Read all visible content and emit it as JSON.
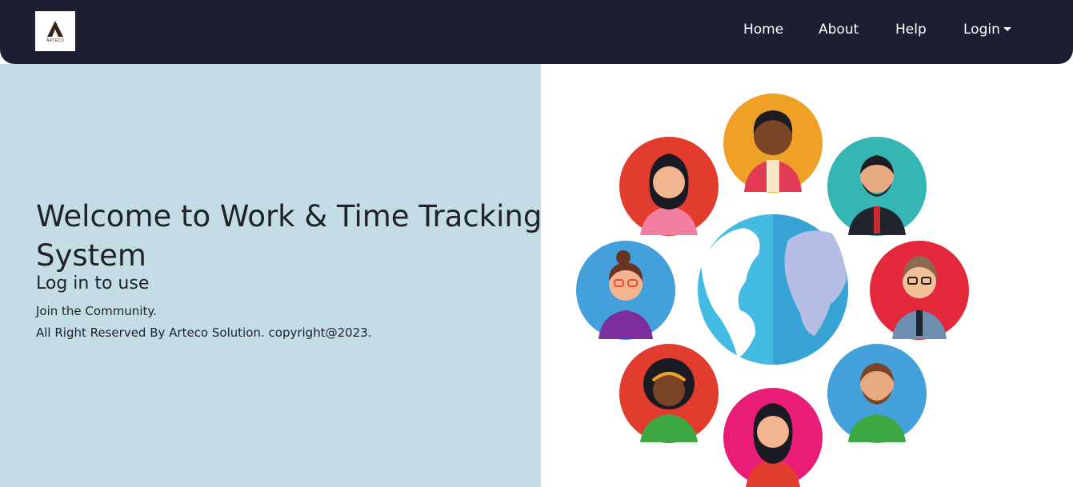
{
  "brand": {
    "logo_text": "ARTECO"
  },
  "nav": {
    "home": "Home",
    "about": "About",
    "help": "Help",
    "login": "Login"
  },
  "hero": {
    "title": "Welcome to Work & Time Tracking System",
    "subtitle": "Log in to use",
    "line1": "Join the Community.",
    "line2": "All Right Reserved By Arteco Solution. copyright@2023."
  },
  "colors": {
    "navbar": "#1b1f31",
    "left_panel": "#c3dce5",
    "text": "#1f2228"
  }
}
